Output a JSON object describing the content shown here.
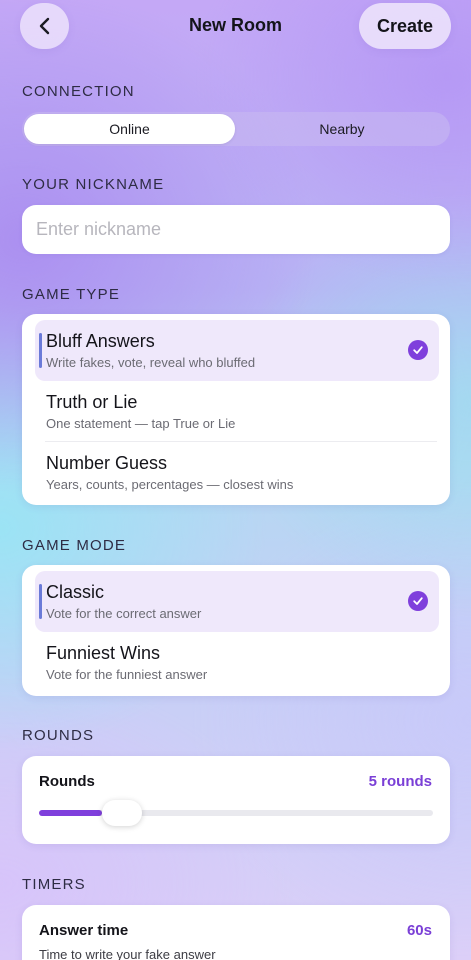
{
  "header": {
    "title": "New Room",
    "create_label": "Create",
    "back_icon": "chevron-left-icon"
  },
  "connection": {
    "label": "CONNECTION",
    "options": [
      "Online",
      "Nearby"
    ],
    "selected": "Online"
  },
  "nickname": {
    "label": "YOUR NICKNAME",
    "placeholder": "Enter nickname",
    "value": ""
  },
  "game_type": {
    "label": "GAME TYPE",
    "options": [
      {
        "title": "Bluff Answers",
        "subtitle": "Write fakes, vote, reveal who bluffed",
        "selected": true
      },
      {
        "title": "Truth or Lie",
        "subtitle": "One statement — tap True or Lie",
        "selected": false
      },
      {
        "title": "Number Guess",
        "subtitle": "Years, counts, percentages — closest wins",
        "selected": false
      }
    ]
  },
  "game_mode": {
    "label": "GAME MODE",
    "options": [
      {
        "title": "Classic",
        "subtitle": "Vote for the correct answer",
        "selected": true
      },
      {
        "title": "Funniest Wins",
        "subtitle": "Vote for the funniest answer",
        "selected": false
      }
    ]
  },
  "rounds": {
    "label": "ROUNDS",
    "field_label": "Rounds",
    "value_text": "5 rounds",
    "slider_fraction": 0.16
  },
  "timers": {
    "label": "TIMERS",
    "answer_time_label": "Answer time",
    "answer_time_value": "60s",
    "answer_time_sub": "Time to write your fake answer"
  },
  "colors": {
    "accent": "#7f3fdc",
    "accent_text": "#7a3fd6",
    "selected_bg": "#efe8fb",
    "selected_bar": "#6a7ad8"
  }
}
